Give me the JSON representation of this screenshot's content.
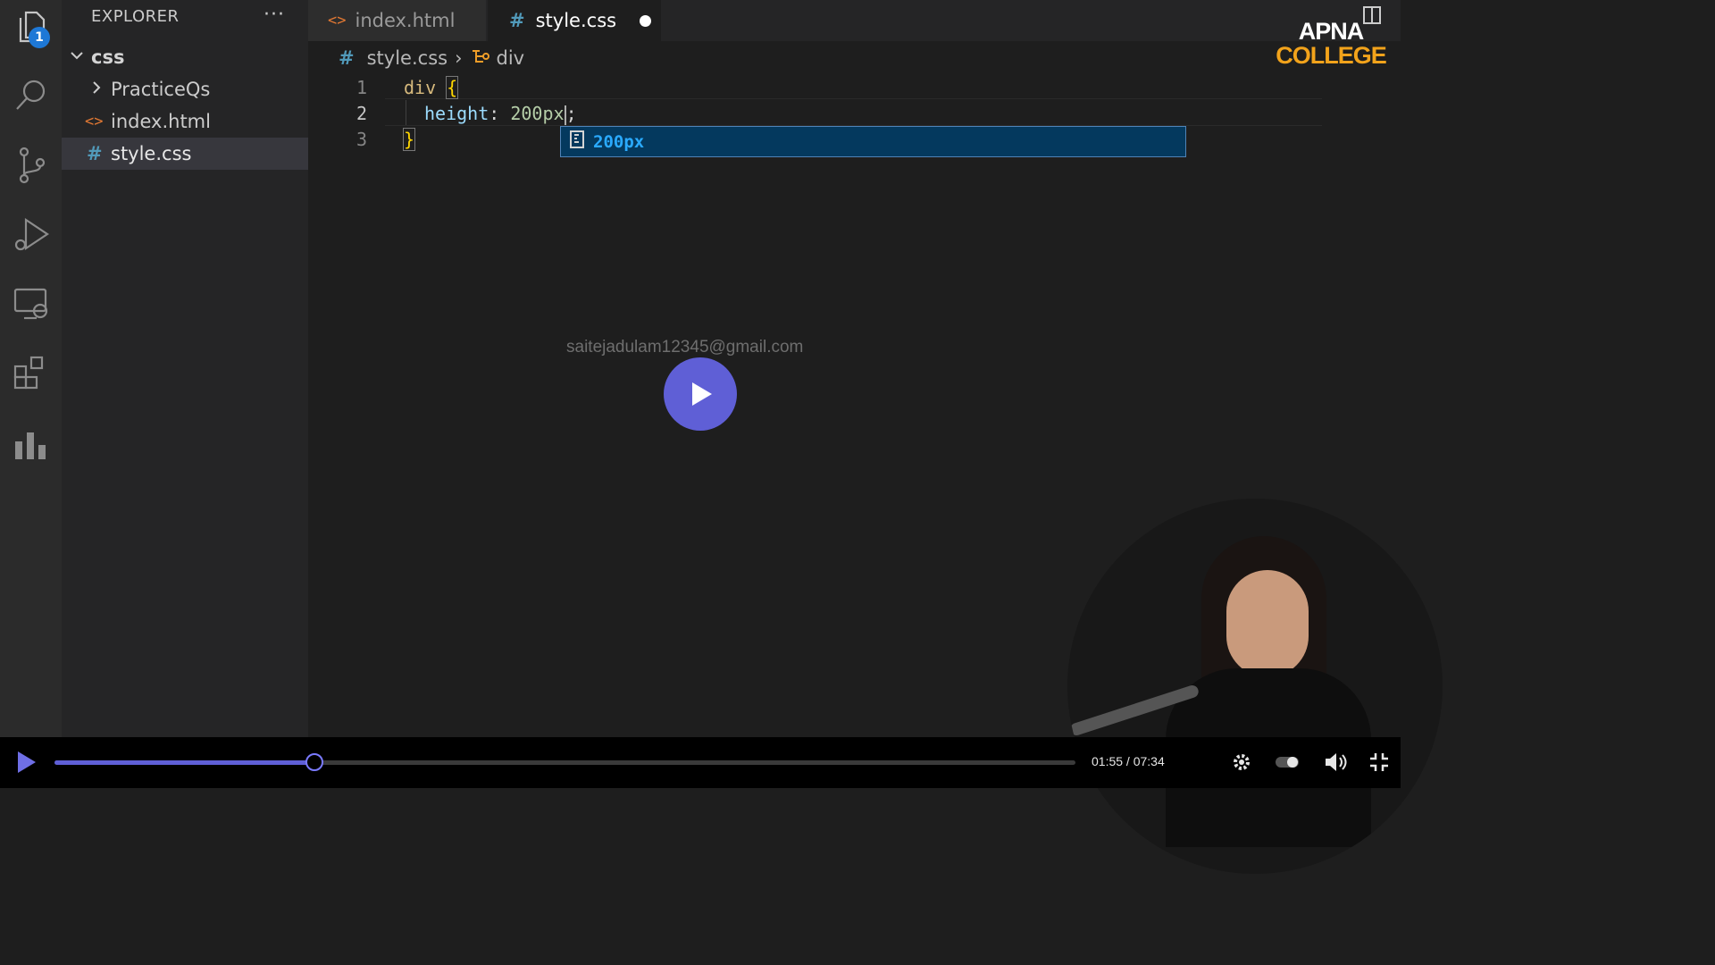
{
  "activity_bar": {
    "explorer_badge": "1",
    "icons": [
      "files-icon",
      "search-icon",
      "source-control-icon",
      "run-debug-icon",
      "remote-explorer-icon",
      "extensions-icon",
      "charts-icon"
    ]
  },
  "sidebar": {
    "title": "EXPLORER",
    "more": "···",
    "folder": "css",
    "items": [
      {
        "label": "PracticeQs",
        "type": "folder"
      },
      {
        "label": "index.html",
        "type": "html"
      },
      {
        "label": "style.css",
        "type": "css",
        "selected": true
      }
    ]
  },
  "tabs": [
    {
      "label": "index.html",
      "icon": "html-file-icon",
      "active": false
    },
    {
      "label": "style.css",
      "icon": "css-hash-icon",
      "active": true,
      "modified": true
    }
  ],
  "breadcrumb": {
    "file": "style.css",
    "symbol": "div",
    "hash": "#",
    "separator": "›"
  },
  "editor": {
    "line_numbers": [
      "1",
      "2",
      "3"
    ],
    "lines": [
      {
        "selector": "div",
        "open": "{"
      },
      {
        "property": "height",
        "colon": ":",
        "value": "200px",
        "semicolon": ";"
      },
      {
        "close": "}"
      }
    ]
  },
  "suggestion": {
    "label": "200px",
    "icon": "unit-ruler-icon"
  },
  "watermark_email": "saitejadulam12345@gmail.com",
  "logo": {
    "line1": "APNA",
    "line2": "COLLEGE"
  },
  "player": {
    "time": "01:55 / 07:34",
    "progress": 0.255,
    "accent": "#5f5fd6",
    "icons": [
      "play-icon",
      "settings-icon",
      "toggle-icon",
      "volume-icon",
      "exit-fullscreen-icon"
    ]
  }
}
